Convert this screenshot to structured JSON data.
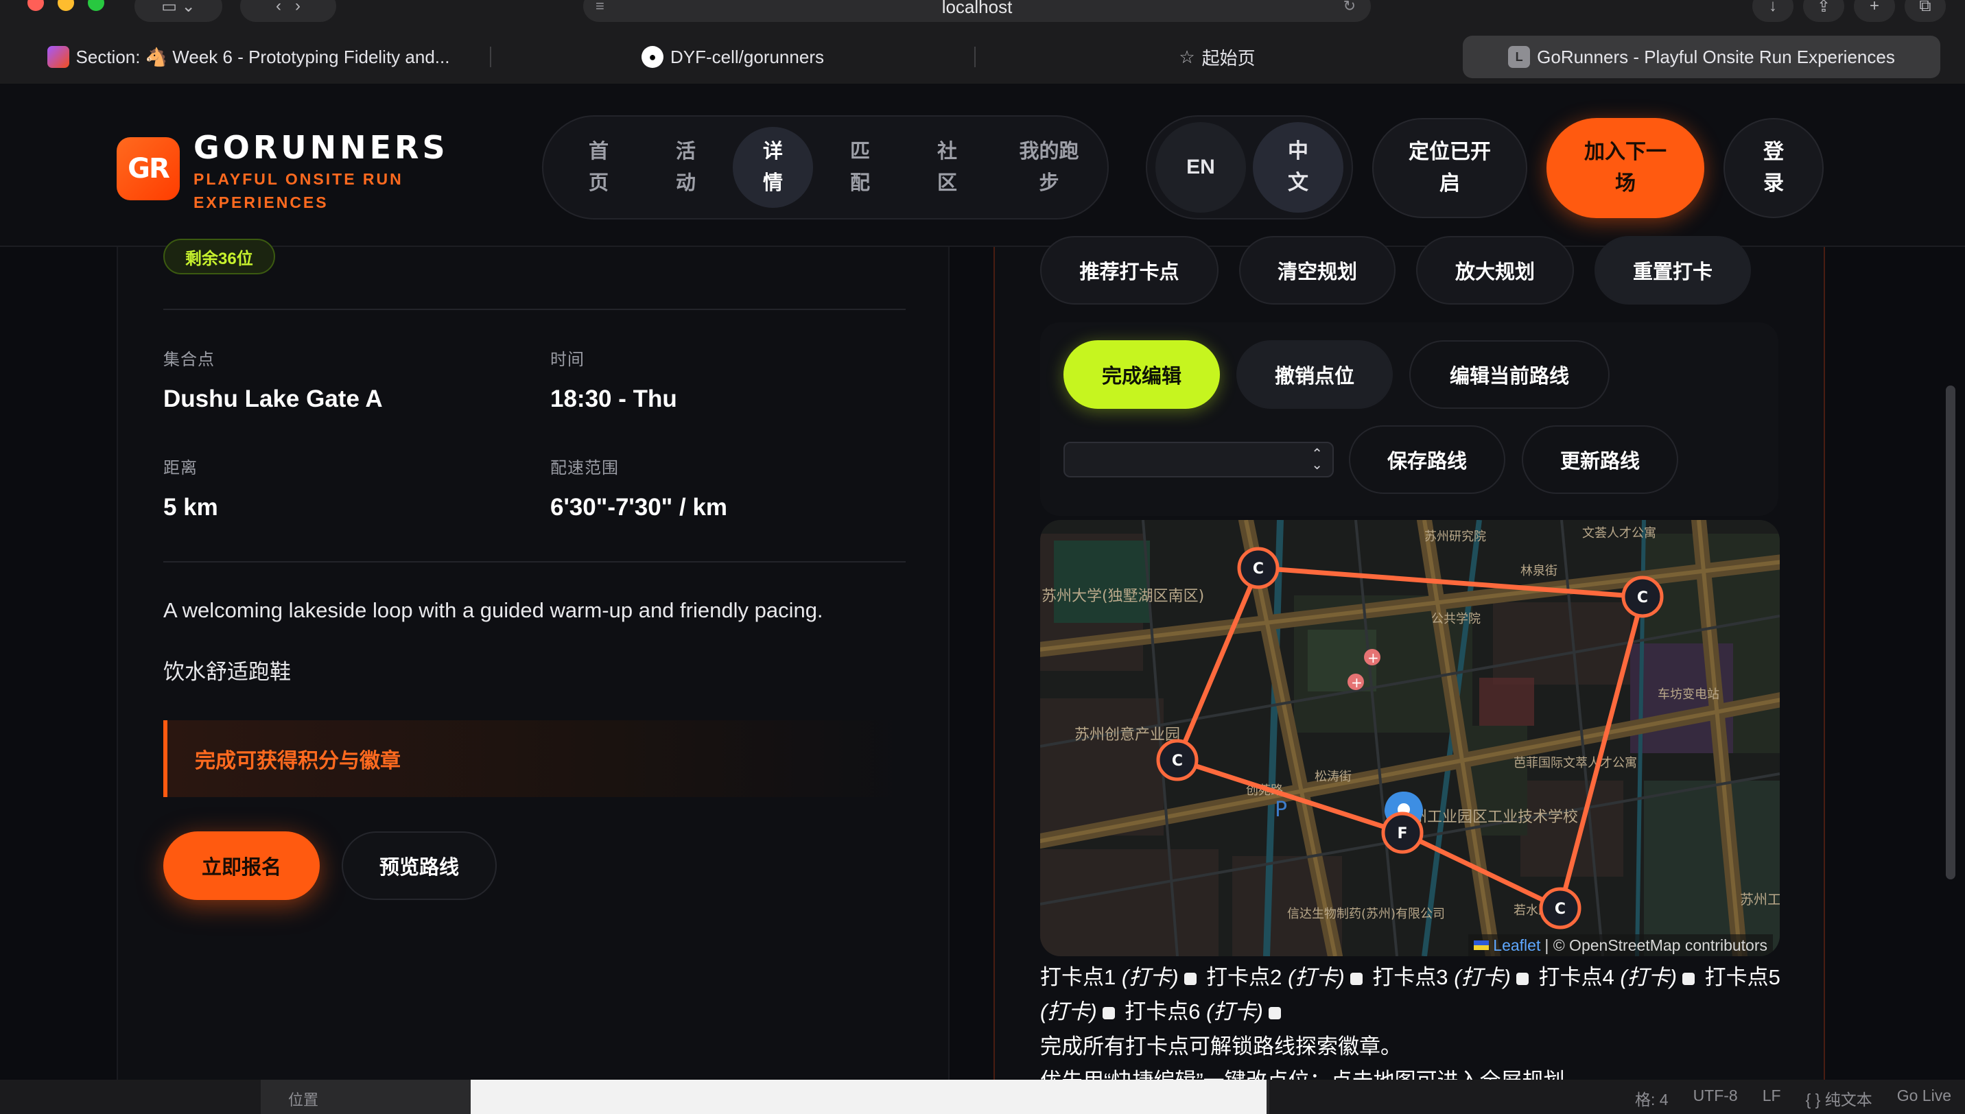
{
  "browser": {
    "url": "localhost",
    "tabs": [
      {
        "label": "Section: 🐴 Week 6 - Prototyping Fidelity and...",
        "icon": "figma-icon",
        "active": false
      },
      {
        "label": "DYF-cell/gorunners",
        "icon": "github-icon",
        "active": false
      },
      {
        "label": "起始页",
        "icon": "star-icon",
        "active": false
      },
      {
        "label": "GoRunners - Playful Onsite Run Experiences",
        "icon": "L",
        "active": true
      }
    ]
  },
  "header": {
    "logo_mark": "GR",
    "logo_title": "GORUNNERS",
    "logo_subtitle": "PLAYFUL ONSITE RUN EXPERIENCES",
    "nav": [
      {
        "label": "首页",
        "active": false
      },
      {
        "label": "活动",
        "active": false
      },
      {
        "label": "详情",
        "active": true
      },
      {
        "label": "匹配",
        "active": false
      },
      {
        "label": "社区",
        "active": false
      },
      {
        "label": "我的跑步",
        "active": false
      }
    ],
    "lang_en": "EN",
    "lang_zh": "中文",
    "location_button": "定位已开启",
    "join_button": "加入下一场",
    "login_button": "登录"
  },
  "event": {
    "spots_badge": "剩余36位",
    "meeting_label": "集合点",
    "meeting_value": "Dushu Lake Gate A",
    "time_label": "时间",
    "time_value": "18:30 - Thu",
    "distance_label": "距离",
    "distance_value": "5 km",
    "pace_label": "配速范围",
    "pace_value": "6'30\"-7'30\" / km",
    "description": "A welcoming lakeside loop with a guided warm-up and friendly pacing.",
    "tips": "饮水舒适跑鞋",
    "reward": "完成可获得积分与徽章",
    "signup_button": "立即报名",
    "preview_button": "预览路线"
  },
  "planner": {
    "recommend_button": "推荐打卡点",
    "clear_button": "清空规划",
    "zoom_button": "放大规划",
    "reset_button": "重置打卡",
    "done_button": "完成编辑",
    "undo_button": "撤销点位",
    "edit_route_button": "编辑当前路线",
    "route_select": "",
    "save_button": "保存路线",
    "update_button": "更新路线",
    "map_attribution_leaflet": "Leaflet",
    "map_attribution_osm": "| © OpenStreetMap contributors",
    "map_markers": {
      "checkpoint": "C",
      "finish": "F"
    },
    "map_labels": [
      "苏州大学(独墅湖区南区)",
      "苏州创意产业园",
      "松涛街",
      "创苑路",
      "苏州工业园区工业技术学校",
      "车坊变电站",
      "芭菲国际文萃人才公寓",
      "信达生物制药(苏州)有限公司",
      "苏州研究院",
      "公共学院",
      "文荟人才公寓",
      "若水路",
      "林泉街",
      "苏州工业园区"
    ],
    "checkpoints": [
      {
        "label": "打卡点1",
        "tag": "(打卡)"
      },
      {
        "label": "打卡点2",
        "tag": "(打卡)"
      },
      {
        "label": "打卡点3",
        "tag": "(打卡)"
      },
      {
        "label": "打卡点4",
        "tag": "(打卡)"
      },
      {
        "label": "打卡点5",
        "tag": "(打卡)"
      },
      {
        "label": "打卡点6",
        "tag": "(打卡)"
      }
    ],
    "note_1": "完成所有打卡点可解锁路线探索徽章。",
    "note_2": "优先用“快捷编辑”一键改点位；点击地图可进入全屏规划。"
  },
  "statusbar": {
    "position_label": "位置",
    "items": [
      "格: 4",
      "UTF-8",
      "LF",
      "{ } 纯文本",
      "Go Live"
    ]
  },
  "colors": {
    "accent_orange": "#ff5a10",
    "accent_lime": "#c6f51f",
    "route_line": "#ff6a3d",
    "background": "#0b0c10"
  }
}
